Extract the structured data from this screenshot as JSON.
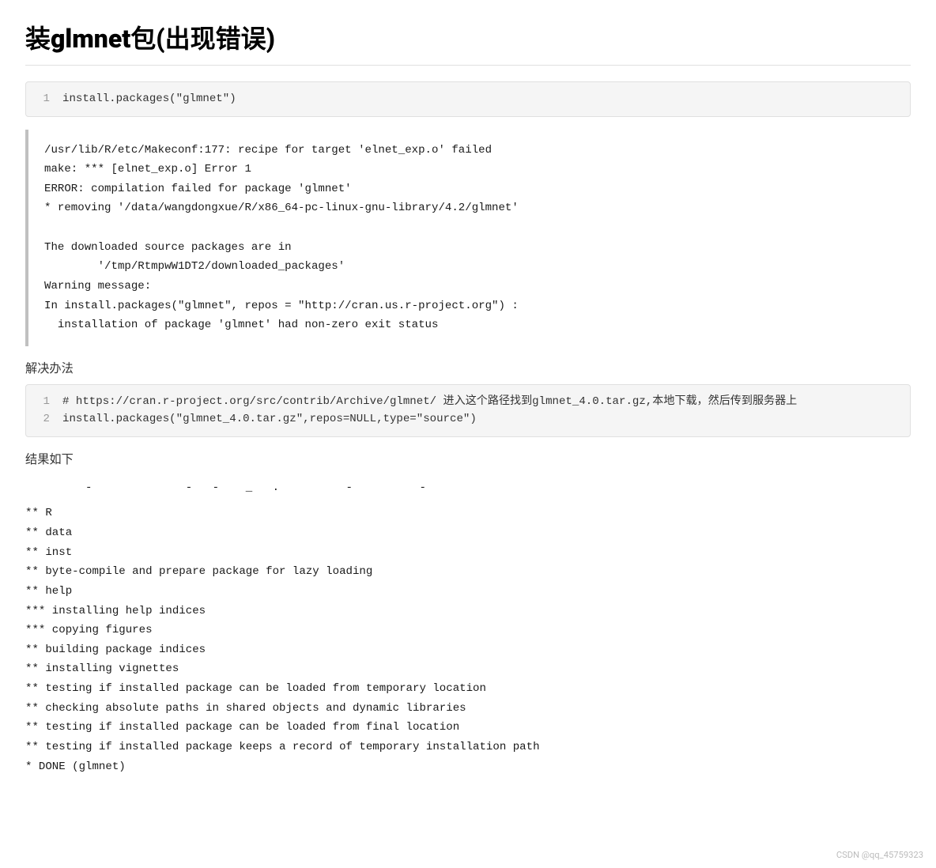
{
  "title": "装glmnet包(出现错误)",
  "install_code_block": {
    "line": "1",
    "code": "install.packages(\"glmnet\")"
  },
  "error_output": "/usr/lib/R/etc/Makeconf:177: recipe for target 'elnet_exp.o' failed\nmake: *** [elnet_exp.o] Error 1\nERROR: compilation failed for package 'glmnet'\n* removing '/data/wangdongxue/R/x86_64-pc-linux-gnu-library/4.2/glmnet'\n\nThe downloaded source packages are in\n        '/tmp/RtmpwW1DT2/downloaded_packages'\nWarning message:\nIn install.packages(\"glmnet\", repos = \"http://cran.us.r-project.org\") :\n  installation of package 'glmnet' had non-zero exit status",
  "solution_label": "解决办法",
  "solution_code": {
    "line1_num": "1",
    "line1_comment": "# https://cran.r-project.org/src/contrib/Archive/glmnet/ 进入这个路径找到glmnet_4.0.tar.gz,本地下载，然后传到服务器上",
    "line2_num": "2",
    "line2_code": "install.packages(\"glmnet_4.0.tar.gz\",repos=NULL,type=\"source\")"
  },
  "result_label": "结果如下",
  "result_output": "** R\n** data\n** inst\n** byte-compile and prepare package for lazy loading\n** help\n*** installing help indices\n*** copying figures\n** building package indices\n** installing vignettes\n** testing if installed package can be loaded from temporary location\n** checking absolute paths in shared objects and dynamic libraries\n** testing if installed package can be loaded from final location\n** testing if installed package keeps a record of temporary installation path\n* DONE (glmnet)",
  "result_header_line": "         -              -   -    _   .          -          -",
  "watermark": "CSDN @qq_45759323"
}
